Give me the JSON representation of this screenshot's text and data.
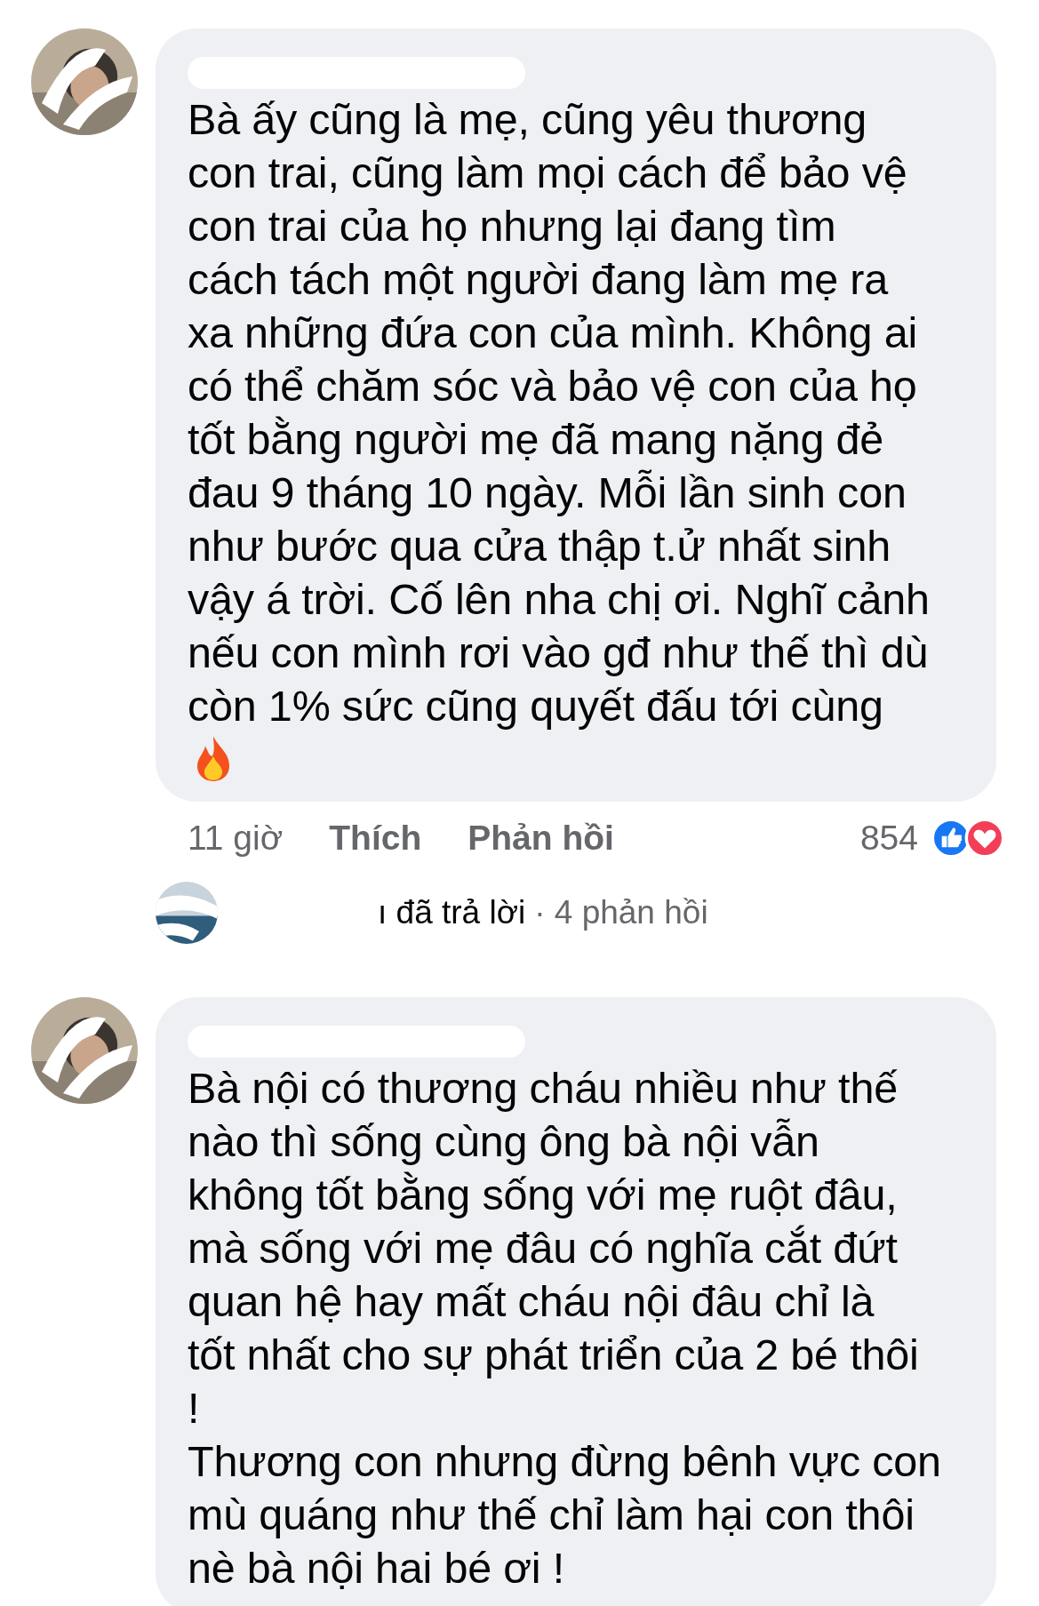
{
  "comments": [
    {
      "text": "Bà ấy cũng là mẹ, cũng yêu thương\ncon trai, cũng làm mọi cách để bảo vệ\ncon trai của họ nhưng lại đang tìm\ncách tách một người đang làm mẹ ra\nxa những đứa con của mình. Không ai\ncó thể chăm sóc và bảo vệ con của họ\ntốt bằng người mẹ đã mang nặng đẻ\nđau 9 tháng 10 ngày. Mỗi lần sinh con\nnhư bước qua cửa thập t.ử nhất sinh\nvậy á trời. Cố lên nha chị ơi. Nghĩ cảnh\nnếu con mình rơi vào gđ như thế thì dù\ncòn 1% sức cũng quyết đấu tới cùng",
      "icon": {
        "kind": "fire"
      },
      "time": "11 giờ",
      "like": "Thích",
      "reply": "Phản hồi",
      "reaction_count": "854",
      "replies": {
        "who": "ı đã trả lời",
        "count": "· 4 phản hồi"
      }
    },
    {
      "text": "Bà nội có thương cháu nhiều như thế\nnào thì sống cùng ông bà nội vẫn\nkhông tốt bằng sống với mẹ ruột đâu,\nmà sống với mẹ đâu có nghĩa cắt đứt\nquan hệ hay mất cháu nội đâu chỉ là\ntốt nhất cho sự phát triển của 2 bé thôi\n!\nThương con nhưng đừng bênh vực con\nmù quáng như thế chỉ làm hại con thôi\nnè bà nội hai bé ơi !"
    }
  ]
}
